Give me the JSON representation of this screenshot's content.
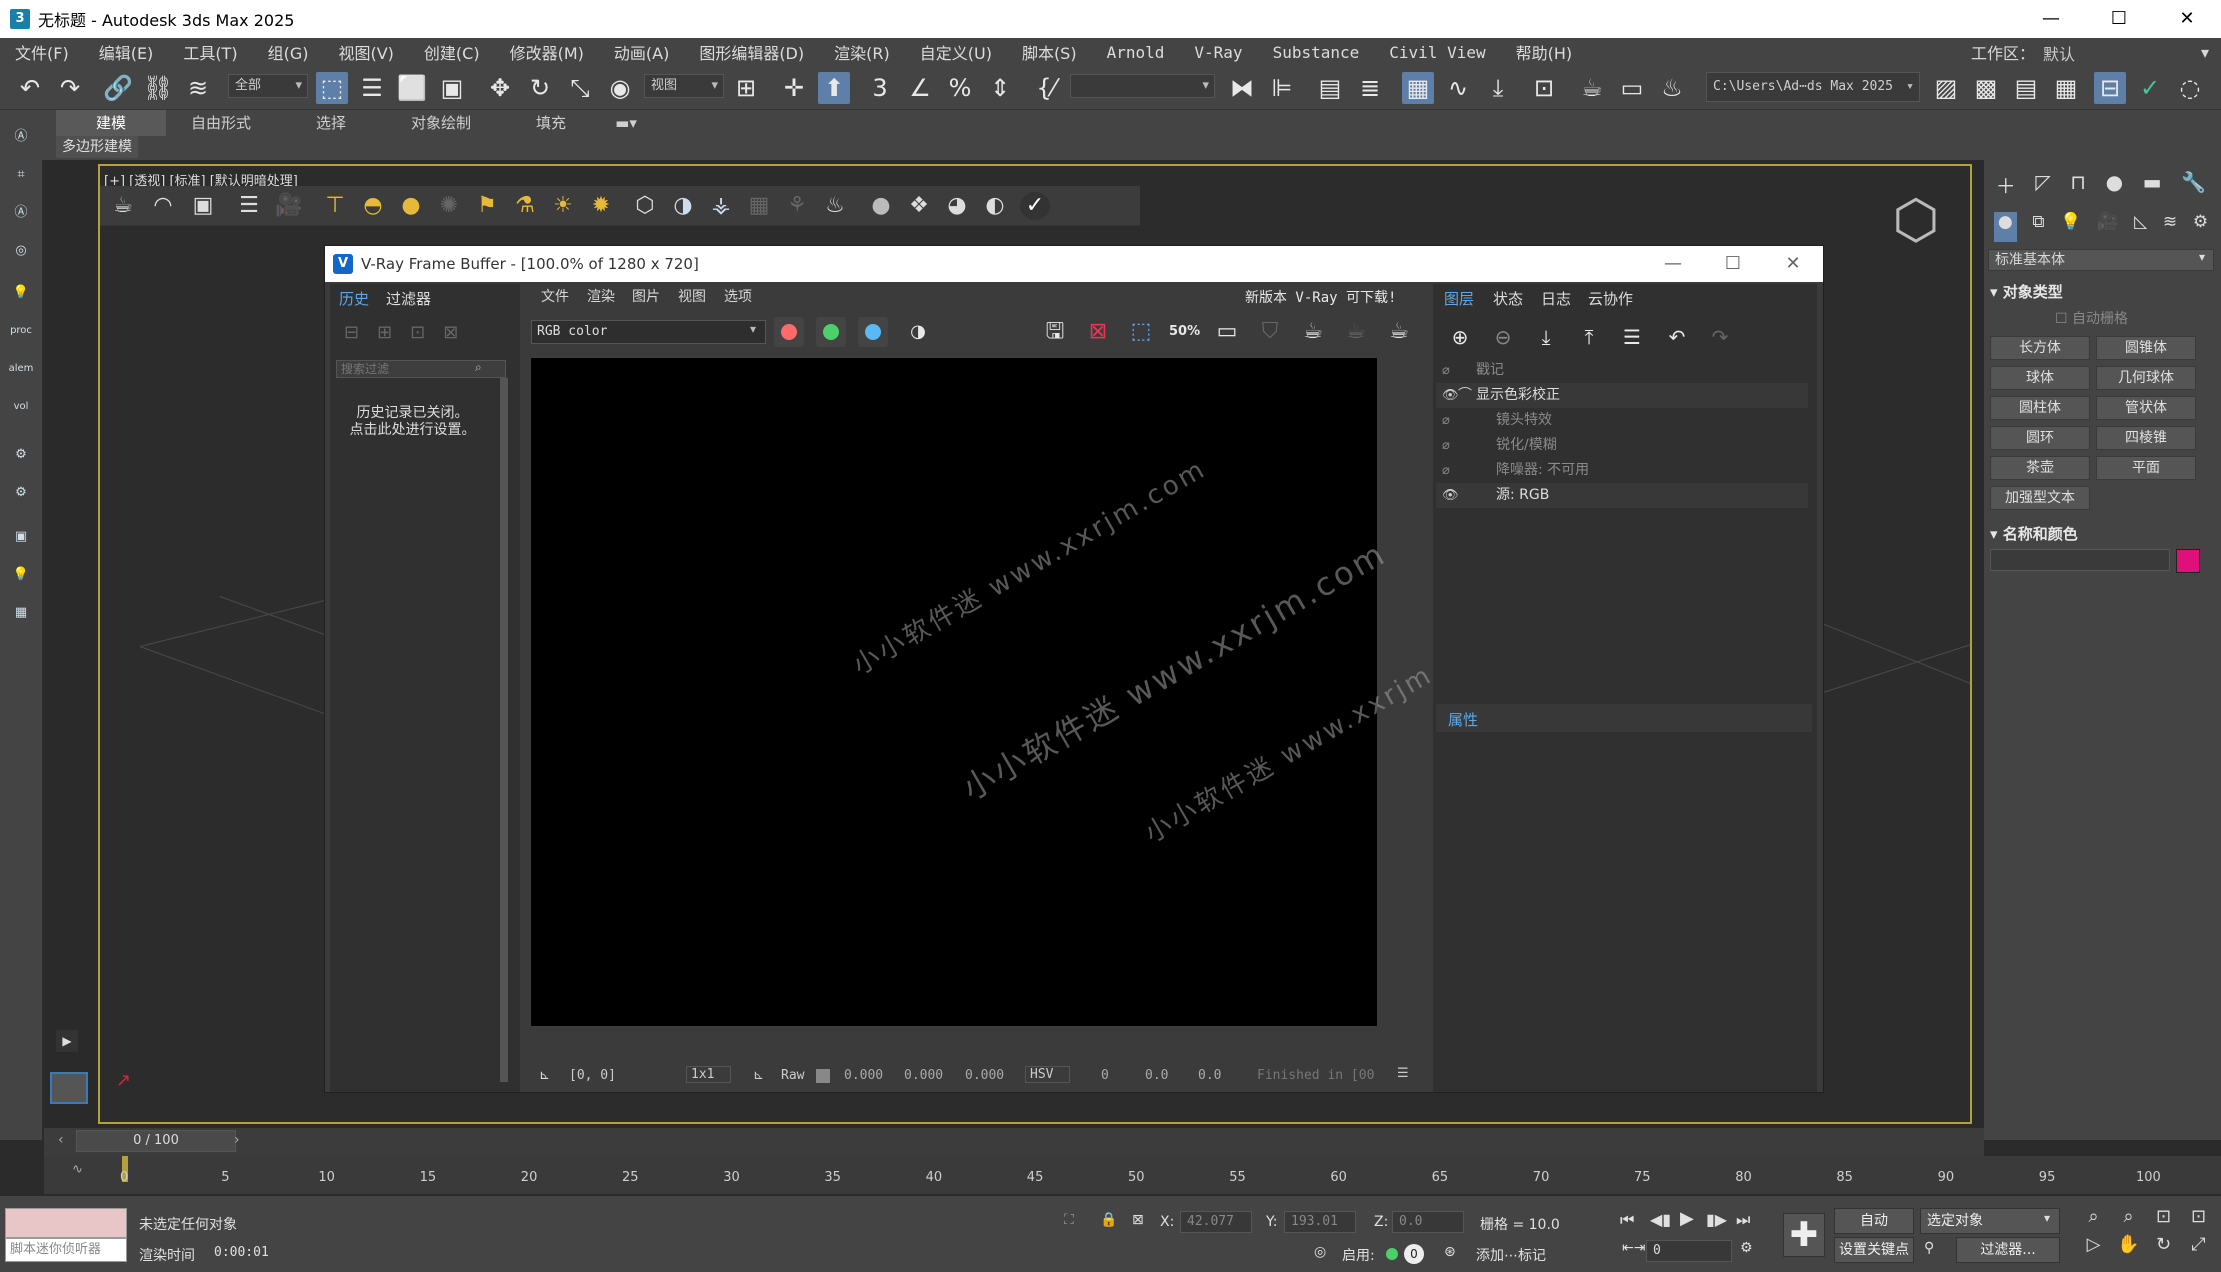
{
  "window": {
    "title": "无标题 - Autodesk 3ds Max 2025",
    "icon": "3",
    "controls": [
      "—",
      "☐",
      "✕"
    ]
  },
  "menubar": {
    "items": [
      "文件(F)",
      "编辑(E)",
      "工具(T)",
      "组(G)",
      "视图(V)",
      "创建(C)",
      "修改器(M)",
      "动画(A)",
      "图形编辑器(D)",
      "渲染(R)",
      "自定义(U)",
      "脚本(S)",
      "Arnold",
      "V-Ray",
      "Substance",
      "Civil View",
      "帮助(H)"
    ],
    "workspace_label": "工作区：",
    "workspace_value": "默认"
  },
  "toolbar": {
    "selection_filter": "全部",
    "ref_coord": "视图",
    "path": "C:\\Users\\Ad⋯ds Max 2025"
  },
  "ribbon": {
    "tabs": [
      "建模",
      "自由形式",
      "选择",
      "对象绘制",
      "填充"
    ],
    "active_tab": "建模",
    "sub_label": "多边形建模"
  },
  "viewport": {
    "label": "[+] [透视] [标准] [默认明暗处理]"
  },
  "vfb": {
    "title": "V-Ray Frame Buffer - [100.0% of 1280 x 720]",
    "left_tabs": [
      "历史",
      "过滤器"
    ],
    "search_placeholder": "搜索过滤",
    "history_msg_1": "历史记录已关闭。",
    "history_msg_2": "点击此处进行设置。",
    "menu": [
      "文件",
      "渲染",
      "图片",
      "视图",
      "选项"
    ],
    "update_notice": "新版本 V-Ray 可下载!",
    "channel": "RGB color",
    "zoom_label": "50%",
    "right_tabs": [
      "图层",
      "状态",
      "日志",
      "云协作"
    ],
    "layers": [
      {
        "label": "戳记",
        "dim": true
      },
      {
        "label": "显示色彩校正",
        "dim": false
      },
      {
        "label": "镜头特效",
        "dim": true
      },
      {
        "label": "锐化/模糊",
        "dim": true
      },
      {
        "label": "降噪器: 不可用",
        "dim": true
      },
      {
        "label": "源: RGB",
        "dim": false
      }
    ],
    "props_label": "属性",
    "watermarks": [
      "小小软件迷 www.xxrjm.com",
      "小小软件迷 www.xxrjm.com",
      "小小软件迷 www.xxrjm.com"
    ],
    "status": {
      "coords": "[0, 0]",
      "ratio": "1x1",
      "raw": "Raw",
      "v1": "0.000",
      "v2": "0.000",
      "v3": "0.000",
      "mode": "HSV",
      "h": "0",
      "s": "0.0",
      "v": "0.0",
      "finished": "Finished in [00"
    }
  },
  "cmdpanel": {
    "category": "标准基本体",
    "obj_type_header": "对象类型",
    "auto_grid": "自动栅格",
    "buttons": [
      "长方体",
      "圆锥体",
      "球体",
      "几何球体",
      "圆柱体",
      "管状体",
      "圆环",
      "四棱锥",
      "茶壶",
      "平面",
      "加强型文本"
    ],
    "name_color_header": "名称和颜色",
    "swatch_color": "#e0107a"
  },
  "timeline": {
    "frame": "0 / 100",
    "ticks": [
      "0",
      "5",
      "10",
      "15",
      "20",
      "25",
      "30",
      "35",
      "40",
      "45",
      "50",
      "55",
      "60",
      "65",
      "70",
      "75",
      "80",
      "85",
      "90",
      "95",
      "100"
    ]
  },
  "statusbar": {
    "script_listener": "脚本迷你侦听器",
    "selection": "未选定任何对象",
    "render_time_label": "渲染时间",
    "render_time": "0:00:01",
    "x_label": "X:",
    "x": "42.077",
    "y_label": "Y:",
    "y": "193.01",
    "z_label": "Z:",
    "z": "0.0",
    "grid": "栅格 = 10.0",
    "enable_label": "启用:",
    "enable_value": "0",
    "add_tag": "添加⋯标记",
    "auto_key": "自动",
    "set_key": "设置关键点",
    "sel_set": "选定对象",
    "filters": "过滤器...",
    "frame_field": "0"
  },
  "colors": {
    "accent": "#5fa7e6",
    "viewport_border": "#b5a13c",
    "red_dot": "#ff6b6b",
    "green_dot": "#4bd06a",
    "blue_dot": "#59b9f4"
  }
}
